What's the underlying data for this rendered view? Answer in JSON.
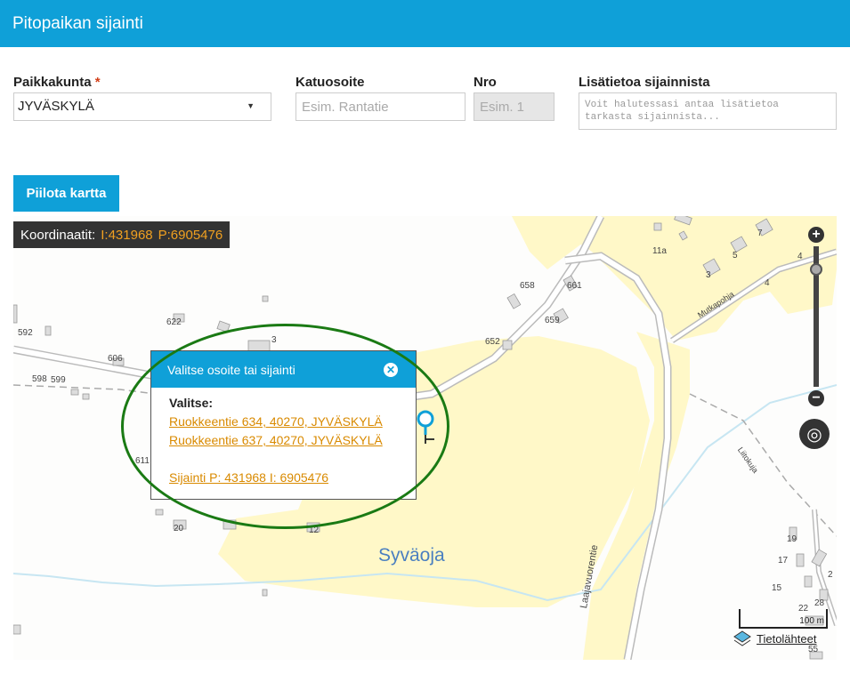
{
  "header": {
    "title": "Pitopaikan sijainti"
  },
  "form": {
    "municipality_label": "Paikkakunta",
    "required_mark": "*",
    "municipality_value": "JYVÄSKYLÄ",
    "street_label": "Katuosoite",
    "street_placeholder": "Esim. Rantatie",
    "street_value": "",
    "nro_label": "Nro",
    "nro_placeholder": "Esim. 1",
    "info_label": "Lisätietoa sijainnista",
    "info_placeholder": "Voit halutessasi antaa lisätietoa tarkasta sijainnista..."
  },
  "hide_map_button": "Piilota kartta",
  "map": {
    "coords_label": "Koordinaatit:",
    "coord_i": "I:431968",
    "coord_p": "P:6905476",
    "labels": {
      "n658": "658",
      "n661": "661",
      "n659": "659",
      "n652": "652",
      "n622": "622",
      "n592": "592",
      "n606": "606",
      "n598": "598",
      "n599": "599",
      "n611": "611",
      "n3a": "3",
      "n20": "20",
      "n12": "12",
      "n11a": "11a",
      "n7": "7",
      "n4a": "4",
      "n5": "5",
      "n3b": "3",
      "n4b": "4",
      "n19": "19",
      "n17": "17",
      "n15": "15",
      "n22": "22",
      "n28": "28",
      "n55": "55",
      "n2": "2",
      "syvaoja": "Syväoja",
      "laajavuorentie": "Laajavuorentie",
      "mutkapohja": "Mutkapohja",
      "liitokuja": "Liitokuja"
    },
    "scale": "100 m",
    "sources": "Tietolähteet",
    "zoom_in": "+",
    "zoom_out": "−"
  },
  "popup": {
    "title": "Valitse osoite tai sijainti",
    "prompt": "Valitse:",
    "options": [
      "Ruokkeentie 634, 40270, JYVÄSKYLÄ",
      "Ruokkeentie 637, 40270, JYVÄSKYLÄ"
    ],
    "location": "Sijainti P: 431968 I: 6905476"
  },
  "colors": {
    "header": "#0fa0d8",
    "accent_link": "#d98a00",
    "highlight_ellipse": "#1a7a14",
    "field_area": "#fff8c8"
  }
}
